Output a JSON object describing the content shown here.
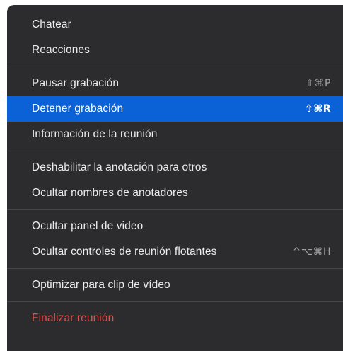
{
  "menu": {
    "items": [
      {
        "label": "Chatear"
      },
      {
        "label": "Reacciones"
      },
      {
        "label": "Pausar grabación",
        "shortcut": "⇧⌘P"
      },
      {
        "label": "Detener grabación",
        "shortcut": "⇧⌘R"
      },
      {
        "label": "Información de la reunión"
      },
      {
        "label": "Deshabilitar la anotación para otros"
      },
      {
        "label": "Ocultar nombres de anotadores"
      },
      {
        "label": "Ocultar panel de video"
      },
      {
        "label": "Ocultar controles de reunión flotantes",
        "shortcut": "^⌥⌘H"
      },
      {
        "label": "Optimizar para clip de vídeo"
      },
      {
        "label": "Finalizar reunión"
      }
    ],
    "selected_item": "Detener grabación",
    "colors": {
      "background": "#2c2c2e",
      "highlight": "#0b61d6",
      "text": "#ececec",
      "danger": "#e2504a",
      "shortcut": "#a3a3a6"
    }
  }
}
